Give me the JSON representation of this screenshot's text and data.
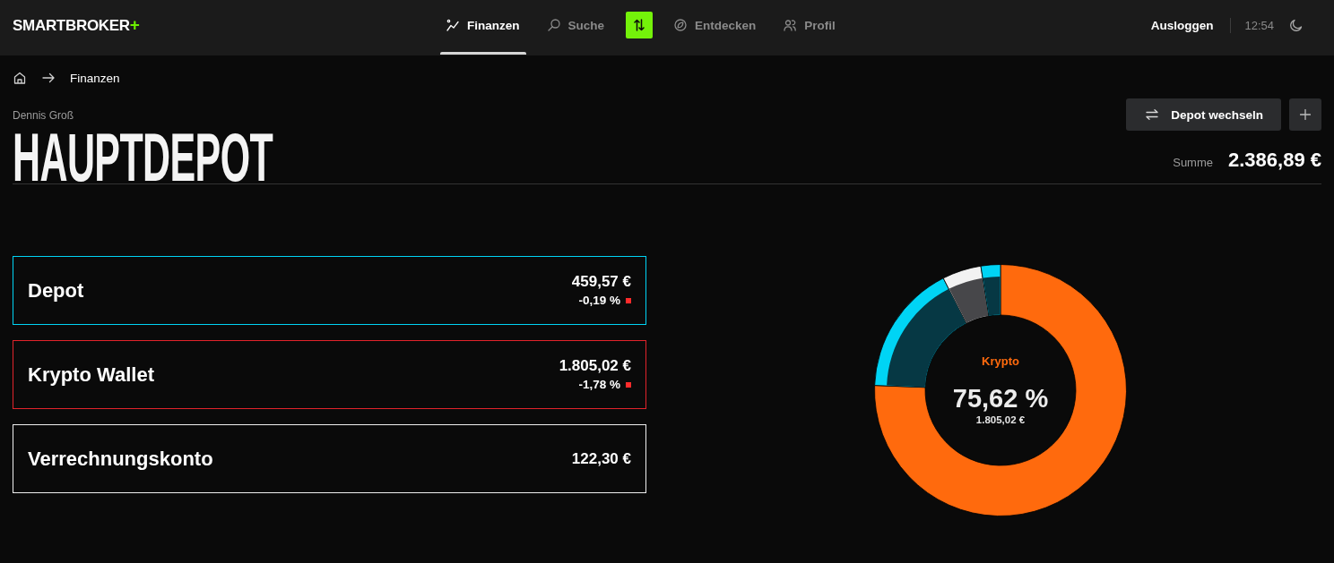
{
  "header": {
    "logo": {
      "name": "SMARTBROKER",
      "mark": "+"
    },
    "nav": [
      {
        "kind": "link",
        "label": "Finanzen",
        "selected": true
      },
      {
        "kind": "link",
        "label": "Suche",
        "selected": false
      },
      {
        "kind": "action",
        "selected": false
      },
      {
        "kind": "link",
        "label": "Entdecken",
        "selected": false
      },
      {
        "kind": "link",
        "label": "Profil",
        "selected": false
      }
    ],
    "logout": "Ausloggen",
    "time": "12:54"
  },
  "breadcrumb": {
    "current": "Finanzen"
  },
  "depot": {
    "owner": "Dennis Groß",
    "title": "HAUPTDEPOT",
    "switch_button": "Depot wechseln",
    "total_label": "Summe",
    "total": "2.386,89 €"
  },
  "accounts": [
    {
      "name": "Depot",
      "amount": "459,57 €",
      "change": "-0,19 %",
      "negative": true,
      "color": "#00d4f5"
    },
    {
      "name": "Krypto Wallet",
      "amount": "1.805,02 €",
      "change": "-1,78 %",
      "negative": true,
      "color": "#e2232b"
    },
    {
      "name": "Verrechnungskonto",
      "amount": "122,30 €",
      "color": "#f0f0f0"
    }
  ],
  "allocation": {
    "label": "Krypto",
    "percent": "75,62 %",
    "amount": "1.805,02 €"
  }
}
